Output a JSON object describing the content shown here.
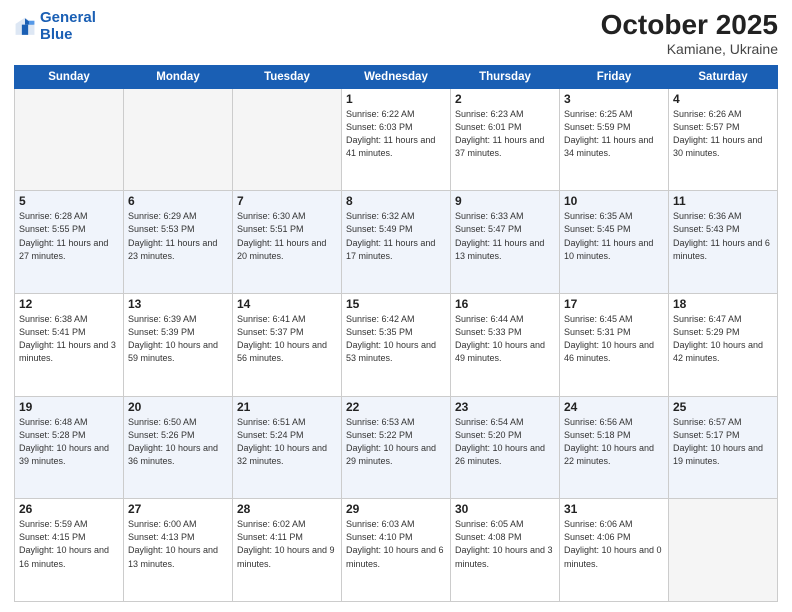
{
  "logo": {
    "line1": "General",
    "line2": "Blue"
  },
  "title": "October 2025",
  "subtitle": "Kamiane, Ukraine",
  "days_of_week": [
    "Sunday",
    "Monday",
    "Tuesday",
    "Wednesday",
    "Thursday",
    "Friday",
    "Saturday"
  ],
  "weeks": [
    [
      {
        "day": "",
        "info": ""
      },
      {
        "day": "",
        "info": ""
      },
      {
        "day": "",
        "info": ""
      },
      {
        "day": "1",
        "info": "Sunrise: 6:22 AM\nSunset: 6:03 PM\nDaylight: 11 hours\nand 41 minutes."
      },
      {
        "day": "2",
        "info": "Sunrise: 6:23 AM\nSunset: 6:01 PM\nDaylight: 11 hours\nand 37 minutes."
      },
      {
        "day": "3",
        "info": "Sunrise: 6:25 AM\nSunset: 5:59 PM\nDaylight: 11 hours\nand 34 minutes."
      },
      {
        "day": "4",
        "info": "Sunrise: 6:26 AM\nSunset: 5:57 PM\nDaylight: 11 hours\nand 30 minutes."
      }
    ],
    [
      {
        "day": "5",
        "info": "Sunrise: 6:28 AM\nSunset: 5:55 PM\nDaylight: 11 hours\nand 27 minutes."
      },
      {
        "day": "6",
        "info": "Sunrise: 6:29 AM\nSunset: 5:53 PM\nDaylight: 11 hours\nand 23 minutes."
      },
      {
        "day": "7",
        "info": "Sunrise: 6:30 AM\nSunset: 5:51 PM\nDaylight: 11 hours\nand 20 minutes."
      },
      {
        "day": "8",
        "info": "Sunrise: 6:32 AM\nSunset: 5:49 PM\nDaylight: 11 hours\nand 17 minutes."
      },
      {
        "day": "9",
        "info": "Sunrise: 6:33 AM\nSunset: 5:47 PM\nDaylight: 11 hours\nand 13 minutes."
      },
      {
        "day": "10",
        "info": "Sunrise: 6:35 AM\nSunset: 5:45 PM\nDaylight: 11 hours\nand 10 minutes."
      },
      {
        "day": "11",
        "info": "Sunrise: 6:36 AM\nSunset: 5:43 PM\nDaylight: 11 hours\nand 6 minutes."
      }
    ],
    [
      {
        "day": "12",
        "info": "Sunrise: 6:38 AM\nSunset: 5:41 PM\nDaylight: 11 hours\nand 3 minutes."
      },
      {
        "day": "13",
        "info": "Sunrise: 6:39 AM\nSunset: 5:39 PM\nDaylight: 10 hours\nand 59 minutes."
      },
      {
        "day": "14",
        "info": "Sunrise: 6:41 AM\nSunset: 5:37 PM\nDaylight: 10 hours\nand 56 minutes."
      },
      {
        "day": "15",
        "info": "Sunrise: 6:42 AM\nSunset: 5:35 PM\nDaylight: 10 hours\nand 53 minutes."
      },
      {
        "day": "16",
        "info": "Sunrise: 6:44 AM\nSunset: 5:33 PM\nDaylight: 10 hours\nand 49 minutes."
      },
      {
        "day": "17",
        "info": "Sunrise: 6:45 AM\nSunset: 5:31 PM\nDaylight: 10 hours\nand 46 minutes."
      },
      {
        "day": "18",
        "info": "Sunrise: 6:47 AM\nSunset: 5:29 PM\nDaylight: 10 hours\nand 42 minutes."
      }
    ],
    [
      {
        "day": "19",
        "info": "Sunrise: 6:48 AM\nSunset: 5:28 PM\nDaylight: 10 hours\nand 39 minutes."
      },
      {
        "day": "20",
        "info": "Sunrise: 6:50 AM\nSunset: 5:26 PM\nDaylight: 10 hours\nand 36 minutes."
      },
      {
        "day": "21",
        "info": "Sunrise: 6:51 AM\nSunset: 5:24 PM\nDaylight: 10 hours\nand 32 minutes."
      },
      {
        "day": "22",
        "info": "Sunrise: 6:53 AM\nSunset: 5:22 PM\nDaylight: 10 hours\nand 29 minutes."
      },
      {
        "day": "23",
        "info": "Sunrise: 6:54 AM\nSunset: 5:20 PM\nDaylight: 10 hours\nand 26 minutes."
      },
      {
        "day": "24",
        "info": "Sunrise: 6:56 AM\nSunset: 5:18 PM\nDaylight: 10 hours\nand 22 minutes."
      },
      {
        "day": "25",
        "info": "Sunrise: 6:57 AM\nSunset: 5:17 PM\nDaylight: 10 hours\nand 19 minutes."
      }
    ],
    [
      {
        "day": "26",
        "info": "Sunrise: 5:59 AM\nSunset: 4:15 PM\nDaylight: 10 hours\nand 16 minutes."
      },
      {
        "day": "27",
        "info": "Sunrise: 6:00 AM\nSunset: 4:13 PM\nDaylight: 10 hours\nand 13 minutes."
      },
      {
        "day": "28",
        "info": "Sunrise: 6:02 AM\nSunset: 4:11 PM\nDaylight: 10 hours\nand 9 minutes."
      },
      {
        "day": "29",
        "info": "Sunrise: 6:03 AM\nSunset: 4:10 PM\nDaylight: 10 hours\nand 6 minutes."
      },
      {
        "day": "30",
        "info": "Sunrise: 6:05 AM\nSunset: 4:08 PM\nDaylight: 10 hours\nand 3 minutes."
      },
      {
        "day": "31",
        "info": "Sunrise: 6:06 AM\nSunset: 4:06 PM\nDaylight: 10 hours\nand 0 minutes."
      },
      {
        "day": "",
        "info": ""
      }
    ]
  ]
}
